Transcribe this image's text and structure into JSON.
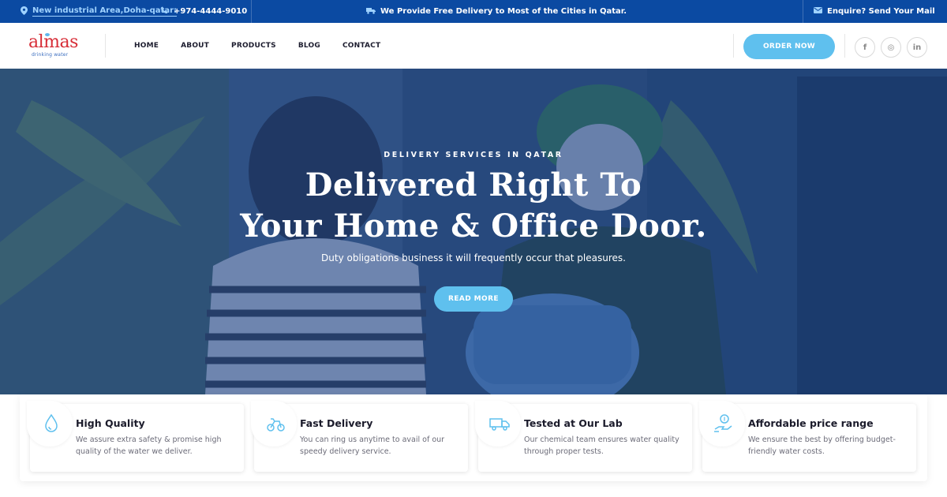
{
  "topbar": {
    "address": "New industrial Area,Doha-qatar:",
    "phone": "+974-4444-9010",
    "delivery_note": "We Provide Free Delivery to Most of the Cities in Qatar.",
    "mail": "Enquire? Send Your Mail"
  },
  "header": {
    "logo_main": "almas",
    "logo_sub": "drinking water",
    "nav": [
      "HOME",
      "ABOUT",
      "PRODUCTS",
      "BLOG",
      "CONTACT"
    ],
    "order_label": "ORDER NOW",
    "social": [
      "f",
      "◎",
      "in"
    ]
  },
  "hero": {
    "eyebrow": "DELIVERY SERVICES IN QATAR",
    "title_line1": "Delivered Right To",
    "title_line2": "Your Home & Office Door.",
    "subtitle": "Duty obligations business it will frequently occur that pleasures.",
    "button_label": "READ MORE"
  },
  "features": [
    {
      "icon": "water-drop-icon",
      "title": "High Quality",
      "desc": "We assure extra safety & promise high quality of the water we deliver."
    },
    {
      "icon": "delivery-bike-icon",
      "title": "Fast Delivery",
      "desc": "You can ring us anytime to avail of our speedy delivery service."
    },
    {
      "icon": "truck-icon",
      "title": "Tested at Our Lab",
      "desc": "Our chemical team ensures water quality through proper tests."
    },
    {
      "icon": "price-hand-icon",
      "title": "Affordable price range",
      "desc": "We ensure the best by offering budget-friendly water costs."
    }
  ],
  "colors": {
    "topbar": "#0b4aa2",
    "accent": "#5fc0ee",
    "brand_red": "#d72d37"
  }
}
